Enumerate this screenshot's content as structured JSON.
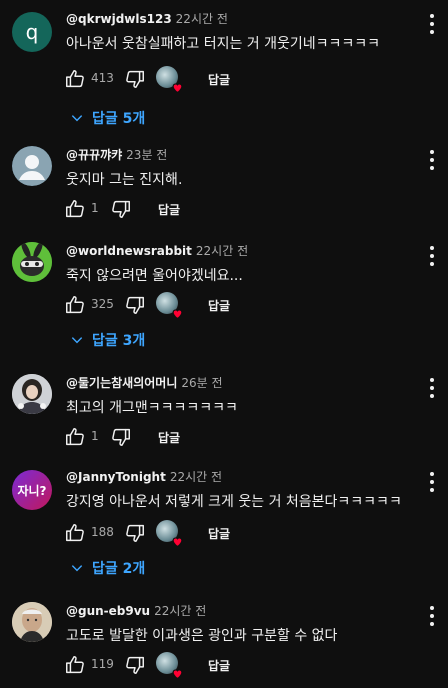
{
  "comments": [
    {
      "handle": "@qkrwjdwls123",
      "time": "22시간 전",
      "text": "아나운서 웃참실패하고 터지는 거 개웃기네ㅋㅋㅋㅋㅋ",
      "likes": "413",
      "reply_label": "답글",
      "replies": "답글 5개",
      "avatar": "letter-q",
      "avatar_letter": "q",
      "hearted": true
    },
    {
      "handle": "@뀨뀨꺄캬",
      "time": "23분 전",
      "text": "웃지마 그는 진지해.",
      "likes": "1",
      "reply_label": "답글",
      "avatar": "default-user",
      "hearted": false
    },
    {
      "handle": "@worldnewsrabbit",
      "time": "22시간 전",
      "text": "죽지 않으려면 울어야겠네요...",
      "likes": "325",
      "reply_label": "답글",
      "replies": "답글 3개",
      "avatar": "rabbit",
      "hearted": true
    },
    {
      "handle": "@둘기는참새의어머니",
      "time": "26분 전",
      "text": "최고의 개그맨ㅋㅋㅋㅋㅋㅋㅋ",
      "likes": "1",
      "reply_label": "답글",
      "avatar": "photo-girl",
      "hearted": false
    },
    {
      "handle": "@JannyTonight",
      "time": "22시간 전",
      "text": "강지영 아나운서 저렇게 크게 웃는 거 처음본다ㅋㅋㅋㅋㅋ",
      "likes": "188",
      "reply_label": "답글",
      "replies": "답글 2개",
      "avatar": "jani-logo",
      "avatar_letter": "자니?",
      "hearted": true
    },
    {
      "handle": "@gun-eb9vu",
      "time": "22시간 전",
      "text": "고도로 발달한 이과생은 광인과 구분할 수 없다",
      "likes": "119",
      "reply_label": "답글",
      "avatar": "photo-man",
      "hearted": true
    }
  ],
  "colors": {
    "background": "#0f0f0f",
    "link": "#3ea6ff",
    "muted": "#aaaaaa",
    "heart": "#ff0033"
  }
}
